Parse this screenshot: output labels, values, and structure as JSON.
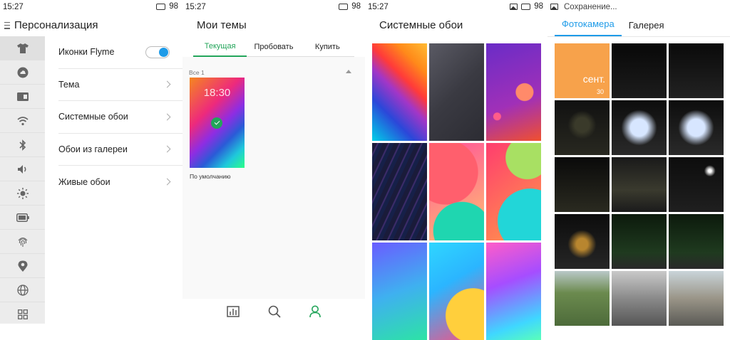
{
  "p1": {
    "status": {
      "time": "15:27",
      "battery": "98"
    },
    "title": "Персонализация",
    "sidebar_icons": [
      "tshirt-icon",
      "cloud-icon",
      "sim-icon",
      "wifi-icon",
      "bluetooth-icon",
      "volume-icon",
      "brightness-icon",
      "battery-icon",
      "fingerprint-icon",
      "location-icon",
      "globe-icon",
      "apps-icon"
    ],
    "rows": [
      {
        "label": "Иконки Flyme",
        "control": "toggle",
        "on": true
      },
      {
        "label": "Тема",
        "control": "chevron"
      },
      {
        "label": "Системные обои",
        "control": "chevron"
      },
      {
        "label": "Обои из галереи",
        "control": "chevron"
      },
      {
        "label": "Живые обои",
        "control": "chevron"
      }
    ]
  },
  "p2": {
    "status": {
      "time": "15:27",
      "battery": "98"
    },
    "title": "Мои темы",
    "tabs": [
      {
        "label": "Текущая",
        "active": true
      },
      {
        "label": "Пробовать",
        "active": false
      },
      {
        "label": "Купить",
        "active": false
      }
    ],
    "section": "Все 1",
    "theme": {
      "name": "По умолчанию",
      "clock": "18:30"
    },
    "bottom_icons": [
      "chart-icon",
      "search-icon",
      "user-icon"
    ],
    "accent": "#23a55a"
  },
  "p3": {
    "status": {
      "time": "15:27",
      "battery": "98"
    },
    "title": "Системные обои",
    "wallpapers": 9
  },
  "p4": {
    "status": {
      "title": "Сохранение..."
    },
    "tabs": [
      {
        "label": "Фотокамера",
        "active": true
      },
      {
        "label": "Галерея",
        "active": false
      }
    ],
    "month_tile": {
      "month": "сент.",
      "count": "30"
    },
    "accent": "#1e9be8"
  }
}
